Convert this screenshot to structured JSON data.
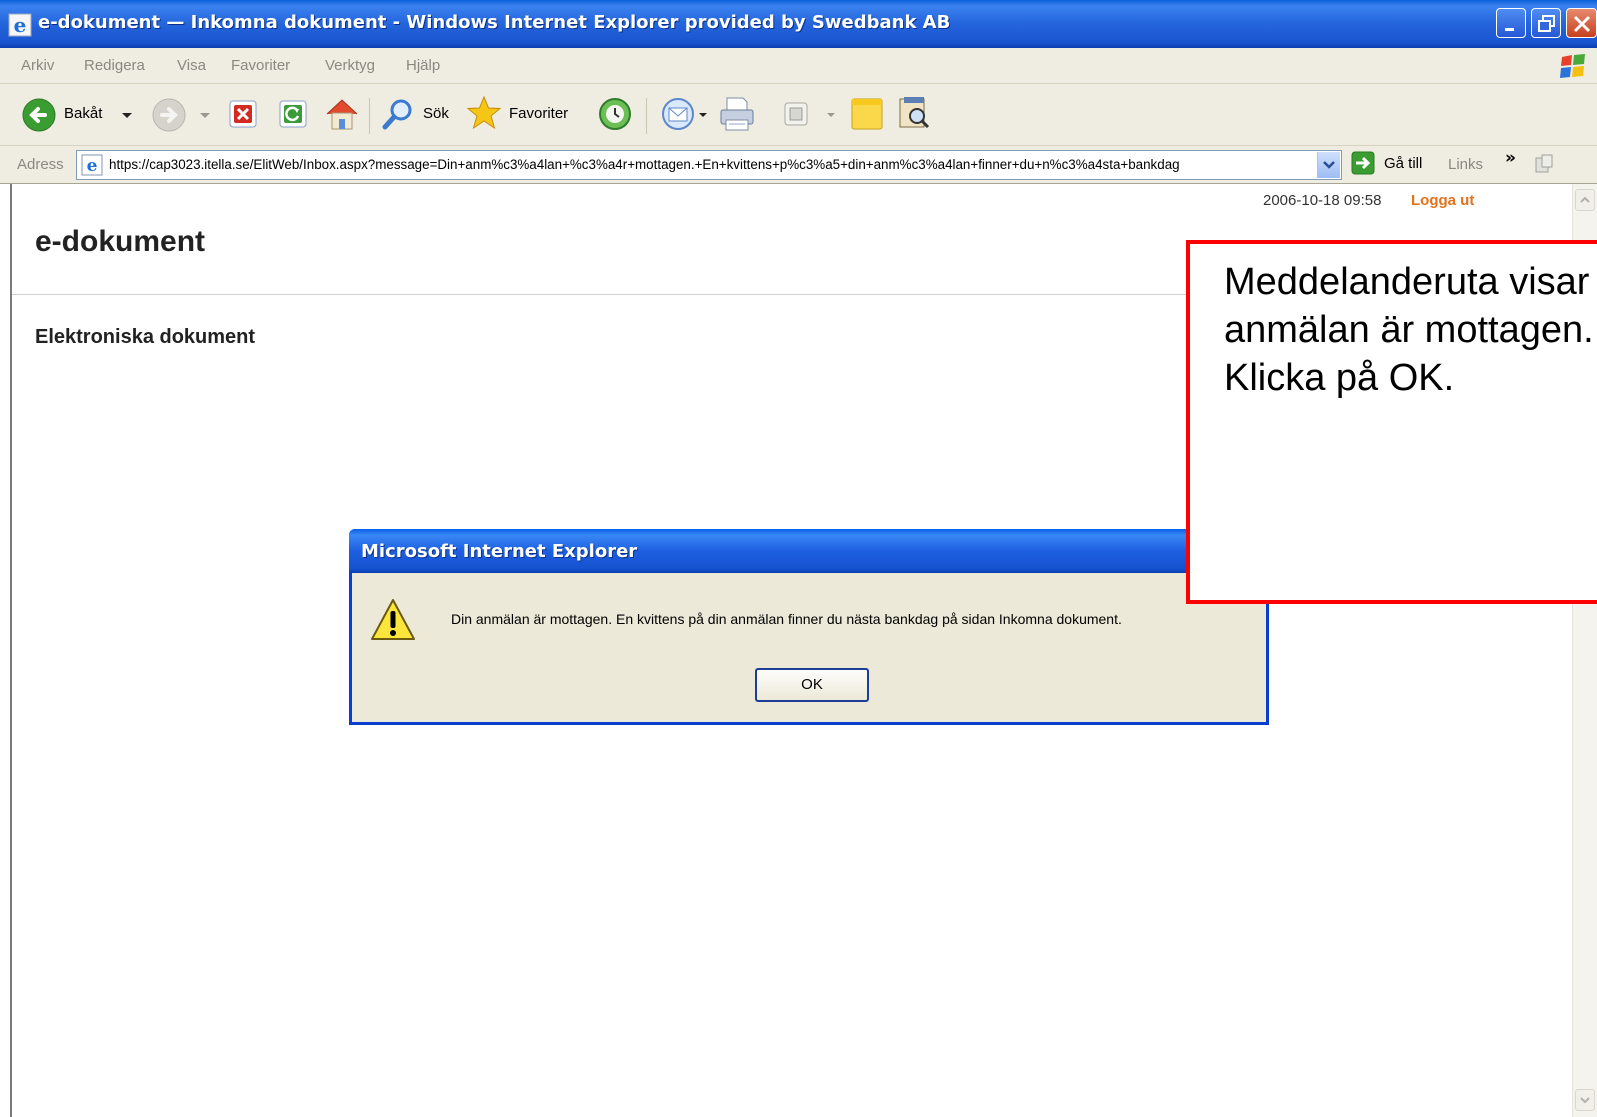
{
  "window": {
    "title": "e-dokument — Inkomna dokument - Windows Internet Explorer provided by Swedbank AB"
  },
  "menu": {
    "items": [
      "Arkiv",
      "Redigera",
      "Visa",
      "Favoriter",
      "Verktyg",
      "Hjälp"
    ]
  },
  "toolbar": {
    "back_label": "Bakåt",
    "search_label": "Sök",
    "favorites_label": "Favoriter"
  },
  "address": {
    "label": "Adress",
    "url": "https://cap3023.itella.se/ElitWeb/Inbox.aspx?message=Din+anm%c3%a4lan+%c3%a4r+mottagen.+En+kvittens+p%c3%a5+din+anm%c3%a4lan+finner+du+n%c3%a4sta+bankdag",
    "goto_label": "Gå till",
    "links_label": "Links",
    "chevron": "»"
  },
  "page": {
    "datetime": "2006-10-18 09:58",
    "logout_label": "Logga ut",
    "title": "e-dokument",
    "section_title": "Elektroniska dokument"
  },
  "dialog": {
    "title": "Microsoft Internet Explorer",
    "message": "Din anmälan är mottagen. En kvittens på din anmälan finner du nästa bankdag på sidan Inkomna dokument.",
    "ok_label": "OK"
  },
  "callout": {
    "text": "Meddelanderuta visar att anmälan är mottagen. Klicka på OK."
  },
  "colors": {
    "titlebar_blue": "#2464dc",
    "logout_orange": "#e4711c",
    "callout_border": "#ff0000",
    "dialog_body": "#ece9d8"
  }
}
